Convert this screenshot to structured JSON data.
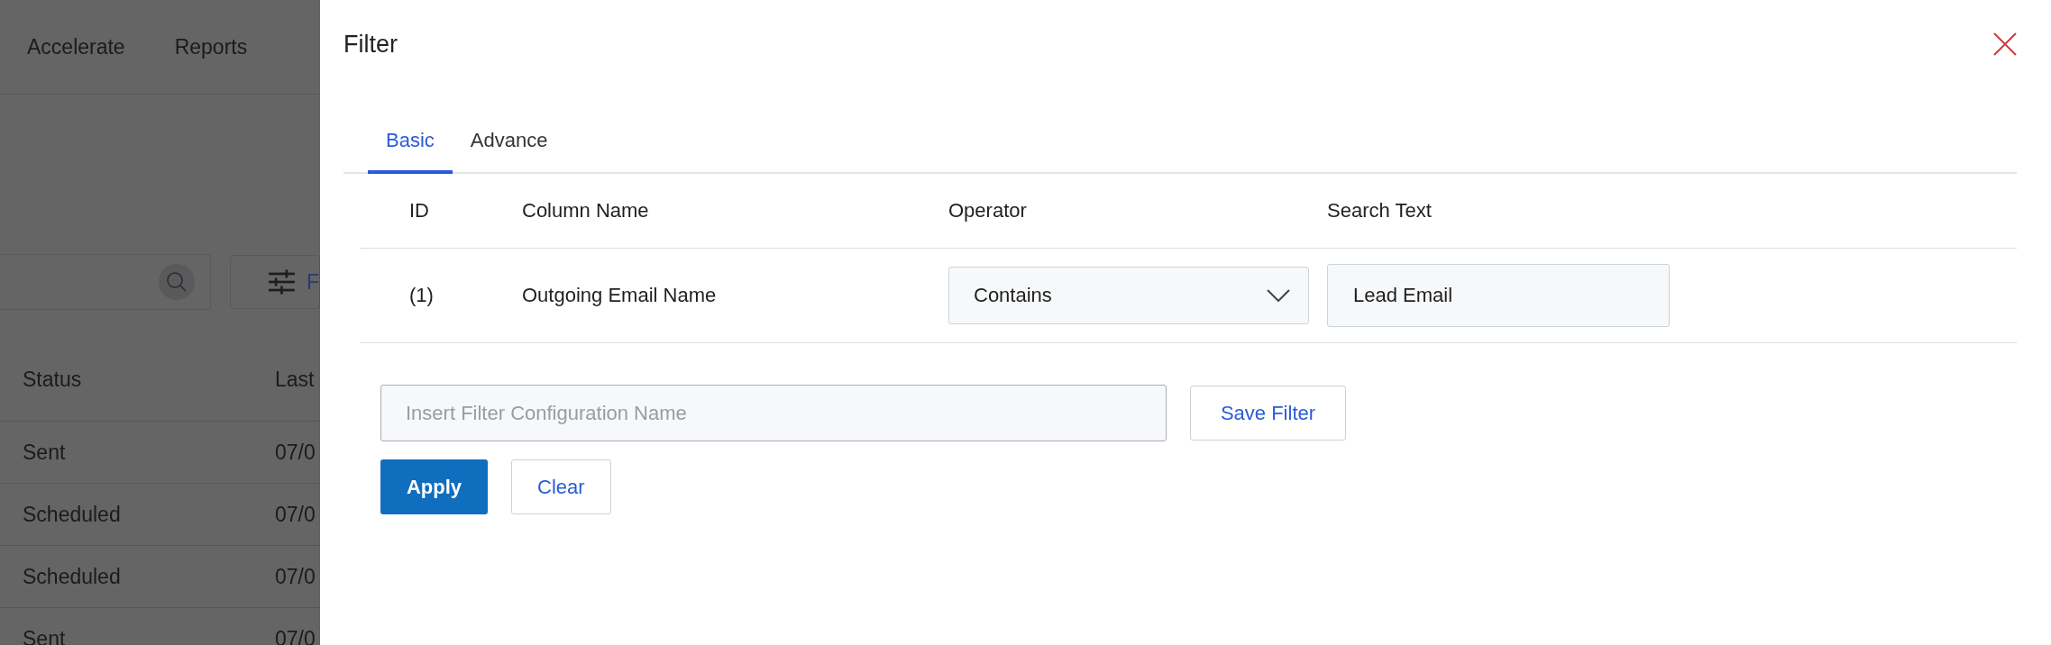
{
  "background": {
    "nav": [
      {
        "label": "Accelerate"
      },
      {
        "label": "Reports"
      }
    ],
    "filter_button": {
      "label": "F"
    },
    "table": {
      "columns": [
        "Status",
        "Last"
      ],
      "rows": [
        [
          "Sent",
          "07/0"
        ],
        [
          "Scheduled",
          "07/0"
        ],
        [
          "Scheduled",
          "07/0"
        ],
        [
          "Sent",
          "07/0"
        ]
      ]
    }
  },
  "dialog": {
    "title": "Filter",
    "tabs": [
      {
        "label": "Basic",
        "selected": true
      },
      {
        "label": "Advance",
        "selected": false
      }
    ],
    "conditions": {
      "columns": [
        "ID",
        "Column Name",
        "Operator",
        "Search Text"
      ],
      "rows": [
        {
          "id": "(1)",
          "column_name": "Outgoing Email Name",
          "operator": "Contains",
          "search_text": "Lead Email"
        }
      ]
    },
    "config_name": {
      "placeholder": "Insert Filter Configuration Name"
    },
    "save_button": "Save Filter",
    "apply_button": "Apply",
    "clear_button": "Clear"
  }
}
